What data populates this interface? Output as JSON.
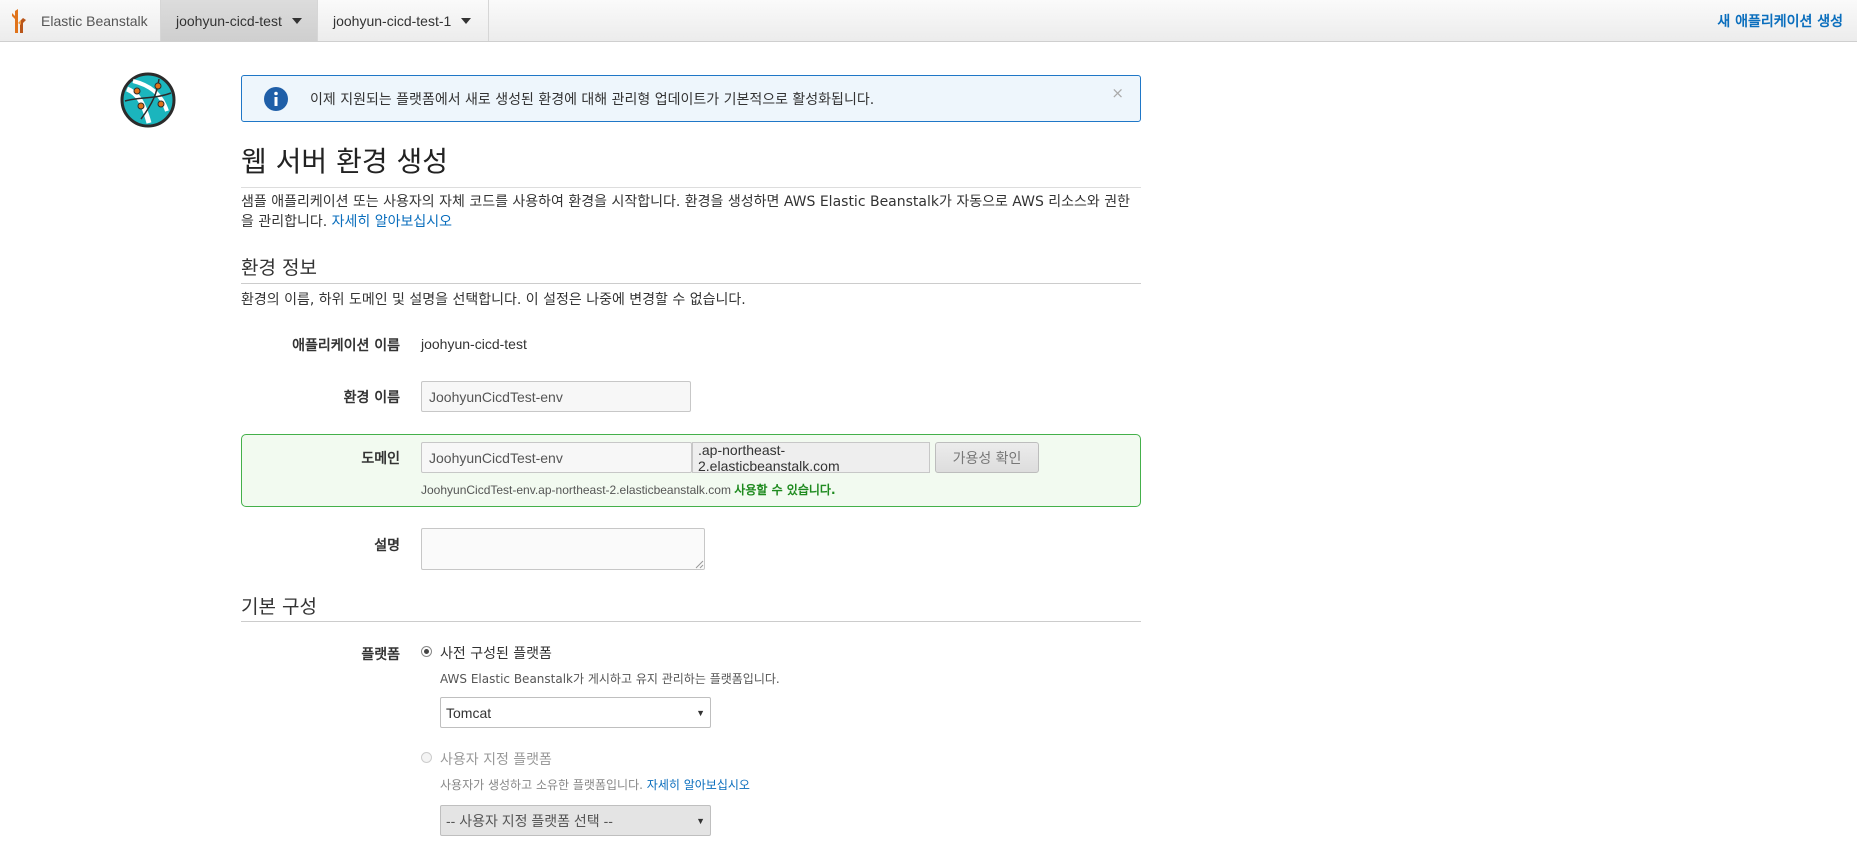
{
  "nav": {
    "brand": "Elastic Beanstalk",
    "tabs": [
      {
        "label": "joohyun-cicd-test"
      },
      {
        "label": "joohyun-cicd-test-1"
      }
    ],
    "new_app": "새 애플리케이션 생성"
  },
  "alert": {
    "text": "이제 지원되는 플랫폼에서 새로 생성된 환경에 대해 관리형 업데이트가 기본적으로 활성화됩니다.",
    "close": "×"
  },
  "page": {
    "title": "웹 서버 환경 생성",
    "intro": "샘플 애플리케이션 또는 사용자의 자체 코드를 사용하여 환경을 시작합니다. 환경을 생성하면 AWS Elastic Beanstalk가 자동으로 AWS 리소스와 권한을 관리합니다.",
    "intro_link": "자세히 알아보십시오"
  },
  "env_info": {
    "title": "환경 정보",
    "desc": "환경의 이름, 하위 도메인 및 설명을 선택합니다. 이 설정은 나중에 변경할 수 없습니다.",
    "app_name_label": "애플리케이션 이름",
    "app_name_value": "joohyun-cicd-test",
    "env_name_label": "환경 이름",
    "env_name_value": "JoohyunCicdTest-env",
    "domain_label": "도메인",
    "domain_value": "JoohyunCicdTest-env",
    "domain_suffix": ".ap-northeast-2.elasticbeanstalk.com",
    "check_button": "가용성 확인",
    "domain_full": "JoohyunCicdTest-env.ap-northeast-2.elasticbeanstalk.com",
    "domain_available": "사용할 수 있습니다.",
    "desc_label": "설명",
    "desc_value": ""
  },
  "base_config": {
    "title": "기본 구성",
    "platform_label": "플랫폼",
    "preconfigured_label": "사전 구성된 플랫폼",
    "preconfigured_desc": "AWS Elastic Beanstalk가 게시하고 유지 관리하는 플랫폼입니다.",
    "platform_selected": "Tomcat",
    "custom_label": "사용자 지정 플랫폼",
    "custom_desc": "사용자가 생성하고 소유한 플랫폼입니다.",
    "custom_link": "자세히 알아보십시오",
    "custom_select": "-- 사용자 지정 플랫폼 선택 --"
  }
}
